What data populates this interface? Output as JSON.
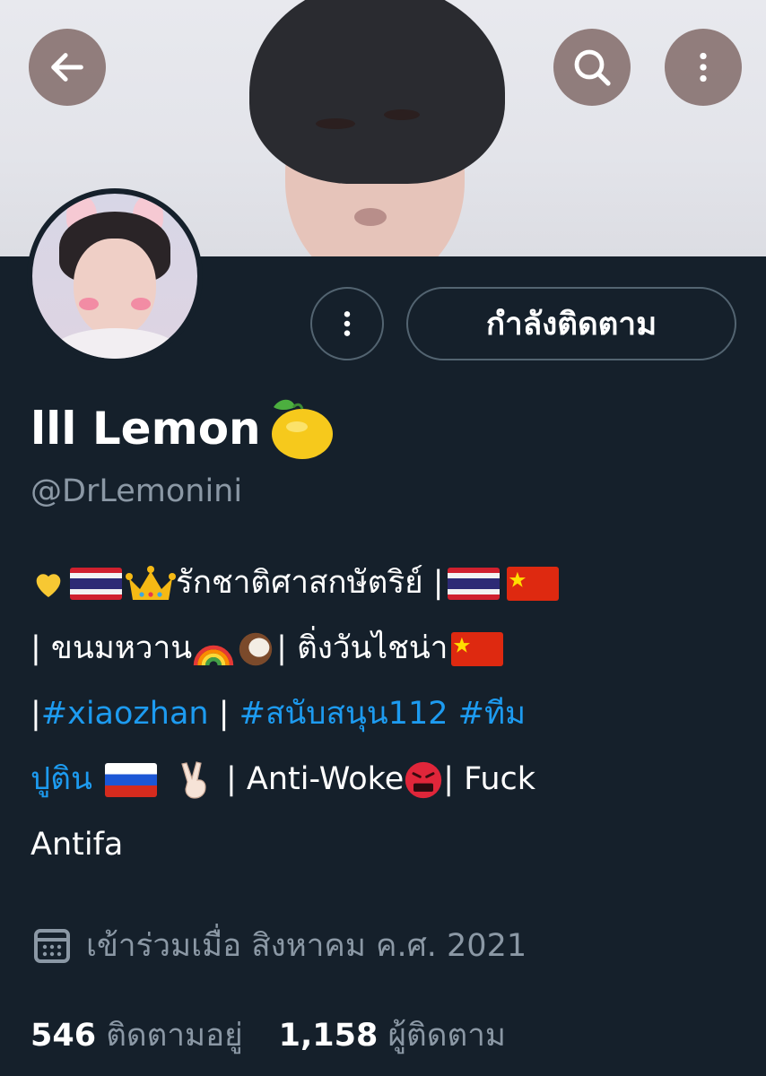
{
  "profile": {
    "name": "lll Lemon",
    "handle": "@DrLemonini",
    "follow_button_label": "กำลังติดตาม"
  },
  "bio": {
    "line1_text": "รักชาติศาสกษัตริย์ |",
    "line2_a": " | ขนมหวาน",
    "line2_b": " | ติ่งวันไชน่า ",
    "line3_sep1": "| ",
    "line3_tag1": "#xiaozhan",
    "line3_sep2": " | ",
    "line3_tag2": "#สนับสนุน112 #ทีม",
    "line4_tag": "ปูติน",
    "line4_text": " | Anti-Woke",
    "line4_text2": "| Fuck",
    "line5_text": "Antifa"
  },
  "joined": {
    "icon": "calendar-icon",
    "text": "เข้าร่วมเมื่อ สิงหาคม ค.ศ. 2021"
  },
  "stats": {
    "following_count": "546",
    "following_label": "ติดตามอยู่",
    "followers_count": "1,158",
    "followers_label": "ผู้ติดตาม"
  },
  "icons": {
    "back": "arrow-left-icon",
    "search": "search-icon",
    "more": "more-vertical-icon"
  },
  "colors": {
    "background": "#15202b",
    "link": "#1d9bf0",
    "secondary_text": "#8b98a5",
    "border": "#536471"
  }
}
